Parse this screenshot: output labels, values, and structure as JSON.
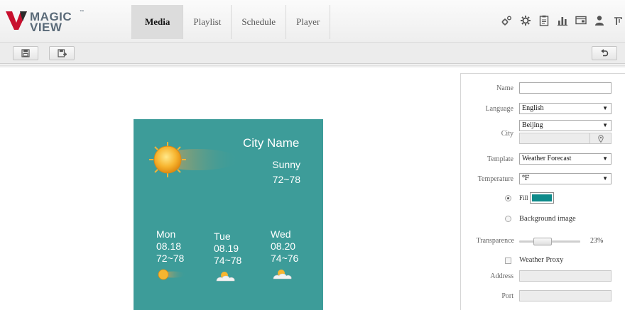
{
  "brand": {
    "line1": "MAGIC",
    "line2": "VIEW",
    "tm": "™",
    "logo_red": "#c8102e"
  },
  "tabs": [
    {
      "label": "Media",
      "active": true
    },
    {
      "label": "Playlist",
      "active": false
    },
    {
      "label": "Schedule",
      "active": false
    },
    {
      "label": "Player",
      "active": false
    }
  ],
  "header_icons": [
    "settings-gears-icon",
    "gear-icon",
    "clipboard-icon",
    "bar-chart-icon",
    "monitor-icon",
    "user-icon",
    "exit-icon"
  ],
  "toolbar": {
    "left_buttons": [
      "save-icon",
      "save-as-icon"
    ],
    "right_button": "undo-icon"
  },
  "preview": {
    "background": "#3d9c99",
    "city": "City Name",
    "condition": "Sunny",
    "range": "72~78",
    "forecast": [
      {
        "day": "Mon",
        "date": "08.18",
        "range": "72~78",
        "icon": "sunny-icon"
      },
      {
        "day": "Tue",
        "date": "08.19",
        "range": "74~78",
        "icon": "cloudy-icon"
      },
      {
        "day": "Wed",
        "date": "08.20",
        "range": "74~76",
        "icon": "cloudy-icon"
      }
    ]
  },
  "panel": {
    "name": {
      "label": "Name",
      "value": ""
    },
    "language": {
      "label": "Language",
      "value": "English"
    },
    "city": {
      "label": "City",
      "value": "Beijing",
      "sub_value": "",
      "sub_icon": "location-pin-icon"
    },
    "template": {
      "label": "Template",
      "value": "Weather Forecast"
    },
    "temperature": {
      "label": "Temperature",
      "value": "℉"
    },
    "fill": {
      "label": "Fill",
      "selected": true,
      "color": "#0d8a8a"
    },
    "background_image": {
      "label": "Background image",
      "selected": false
    },
    "transparence": {
      "label": "Transparence",
      "value": "23%",
      "fraction": 0.23
    },
    "weather_proxy": {
      "label": "Weather Proxy",
      "checked": false
    },
    "address": {
      "label": "Address",
      "value": ""
    },
    "port": {
      "label": "Port",
      "value": ""
    }
  }
}
